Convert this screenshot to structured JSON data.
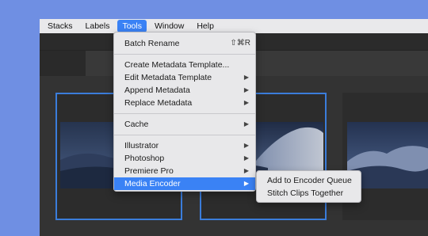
{
  "menubar": {
    "items": [
      {
        "label": "Stacks",
        "active": false
      },
      {
        "label": "Labels",
        "active": false
      },
      {
        "label": "Tools",
        "active": true
      },
      {
        "label": "Window",
        "active": false
      },
      {
        "label": "Help",
        "active": false
      }
    ]
  },
  "tools_menu": {
    "batch_rename": {
      "label": "Batch Rename",
      "shortcut": "⇧⌘R"
    },
    "create_metadata_template": {
      "label": "Create Metadata Template..."
    },
    "edit_metadata_template": {
      "label": "Edit Metadata Template",
      "arrow": "▶"
    },
    "append_metadata": {
      "label": "Append Metadata",
      "arrow": "▶"
    },
    "replace_metadata": {
      "label": "Replace Metadata",
      "arrow": "▶"
    },
    "cache": {
      "label": "Cache",
      "arrow": "▶"
    },
    "illustrator": {
      "label": "Illustrator",
      "arrow": "▶"
    },
    "photoshop": {
      "label": "Photoshop",
      "arrow": "▶"
    },
    "premiere_pro": {
      "label": "Premiere Pro",
      "arrow": "▶"
    },
    "media_encoder": {
      "label": "Media Encoder",
      "arrow": "▶",
      "selected": true
    }
  },
  "media_encoder_submenu": {
    "add_to_queue": "Add to Encoder Queue",
    "stitch_clips": "Stitch Clips Together"
  },
  "colors": {
    "desktop": "#6f8fe3",
    "accent": "#3a82f5",
    "selection_border": "#3b7ddb"
  }
}
